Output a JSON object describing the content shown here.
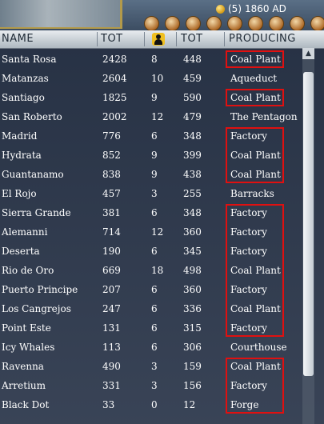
{
  "topbar": {
    "gold": "(5)",
    "year": "1860 AD"
  },
  "header": {
    "name": "NAME",
    "tot": "TOT",
    "citizens_icon": "citizen-icon",
    "tot2": "TOT",
    "producing": "PRODUCING"
  },
  "rows": [
    {
      "name": "Santa Rosa",
      "tot": "2428",
      "cit": "8",
      "tot2": "448",
      "prod": "Coal Plant"
    },
    {
      "name": "Matanzas",
      "tot": "2604",
      "cit": "10",
      "tot2": "459",
      "prod": "Aqueduct"
    },
    {
      "name": "Santiago",
      "tot": "1825",
      "cit": "9",
      "tot2": "590",
      "prod": "Coal Plant"
    },
    {
      "name": "San Roberto",
      "tot": "2002",
      "cit": "12",
      "tot2": "479",
      "prod": "The Pentagon"
    },
    {
      "name": "Madrid",
      "tot": "776",
      "cit": "6",
      "tot2": "348",
      "prod": "Factory"
    },
    {
      "name": "Hydrata",
      "tot": "852",
      "cit": "9",
      "tot2": "399",
      "prod": "Coal Plant"
    },
    {
      "name": "Guantanamo",
      "tot": "838",
      "cit": "9",
      "tot2": "438",
      "prod": "Coal Plant"
    },
    {
      "name": "El Rojo",
      "tot": "457",
      "cit": "3",
      "tot2": "255",
      "prod": "Barracks"
    },
    {
      "name": "Sierra Grande",
      "tot": "381",
      "cit": "6",
      "tot2": "348",
      "prod": "Factory"
    },
    {
      "name": "Alemanni",
      "tot": "714",
      "cit": "12",
      "tot2": "360",
      "prod": "Factory"
    },
    {
      "name": "Deserta",
      "tot": "190",
      "cit": "6",
      "tot2": "345",
      "prod": "Factory"
    },
    {
      "name": "Rio de Oro",
      "tot": "669",
      "cit": "18",
      "tot2": "498",
      "prod": "Coal Plant"
    },
    {
      "name": "Puerto Principe",
      "tot": "207",
      "cit": "6",
      "tot2": "360",
      "prod": "Factory"
    },
    {
      "name": "Los Cangrejos",
      "tot": "247",
      "cit": "6",
      "tot2": "336",
      "prod": "Coal Plant"
    },
    {
      "name": "Point Este",
      "tot": "131",
      "cit": "6",
      "tot2": "315",
      "prod": "Factory"
    },
    {
      "name": "Icy Whales",
      "tot": "113",
      "cit": "6",
      "tot2": "306",
      "prod": "Courthouse"
    },
    {
      "name": "Ravenna",
      "tot": "490",
      "cit": "3",
      "tot2": "159",
      "prod": "Coal Plant"
    },
    {
      "name": "Arretium",
      "tot": "331",
      "cit": "3",
      "tot2": "156",
      "prod": "Factory"
    },
    {
      "name": "Black Dot",
      "tot": "33",
      "cit": "0",
      "tot2": "12",
      "prod": "Forge"
    }
  ],
  "highlights": [
    {
      "from": 0,
      "to": 0
    },
    {
      "from": 2,
      "to": 2
    },
    {
      "from": 4,
      "to": 6
    },
    {
      "from": 8,
      "to": 14
    },
    {
      "from": 16,
      "to": 18
    }
  ],
  "colors": {
    "highlight": "#e01010",
    "text": "#ffffff",
    "header_text": "#1f2a36"
  }
}
